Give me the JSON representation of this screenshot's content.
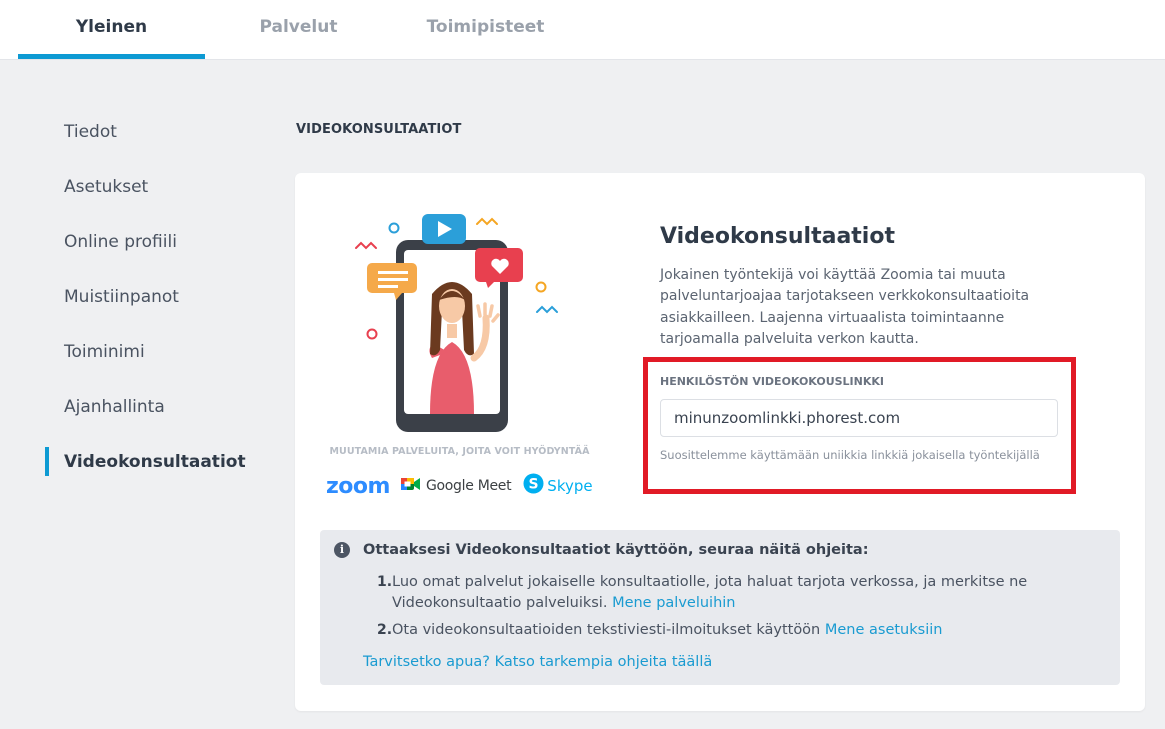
{
  "tabs": [
    {
      "label": "Yleinen",
      "active": true
    },
    {
      "label": "Palvelut",
      "active": false
    },
    {
      "label": "Toimipisteet",
      "active": false
    }
  ],
  "sidebar": {
    "items": [
      {
        "label": "Tiedot"
      },
      {
        "label": "Asetukset"
      },
      {
        "label": "Online profiili"
      },
      {
        "label": "Muistiinpanot"
      },
      {
        "label": "Toiminimi"
      },
      {
        "label": "Ajanhallinta"
      },
      {
        "label": "Videokonsultaatiot",
        "active": true
      }
    ]
  },
  "section": {
    "title": "VIDEOKONSULTAATIOT"
  },
  "card": {
    "services_caption": "MUUTAMIA PALVELUITA, JOITA VOIT HYÖDYNTÄÄ",
    "logos": {
      "zoom": "zoom",
      "google_meet": "Google Meet",
      "skype": "Skype"
    },
    "heading": "Videokonsultaatiot",
    "description": "Jokainen työntekijä voi käyttää Zoomia tai muuta palveluntarjoajaa tarjotakseen verkkokonsultaatioita asiakkailleen. Laajenna virtuaalista toimintaanne tarjoamalla palveluita verkon kautta.",
    "link_label": "HENKILÖSTÖN VIDEOKOKOUSLINKKI",
    "link_value": "minunzoomlinkki.phorest.com",
    "link_hint": "Suosittelemme käyttämään uniikkia linkkiä jokaisella työntekijällä",
    "highlight_color": "#e11a26"
  },
  "info": {
    "title": "Ottaaksesi Videokonsultaatiot käyttöön, seuraa näitä ohjeita:",
    "steps": [
      {
        "num": "1.",
        "text": "Luo omat palvelut jokaiselle konsultaatiolle, jota haluat tarjota verkossa, ja merkitse ne Videokonsultaatio palveluiksi. ",
        "link": "Mene palveluihin"
      },
      {
        "num": "2.",
        "text": "Ota videokonsultaatioiden tekstiviesti-ilmoitukset käyttöön ",
        "link": "Mene asetuksiin"
      }
    ],
    "help_link": "Tarvitsetko apua? Katso tarkempia ohjeita täällä"
  },
  "colors": {
    "accent": "#0d9ad3",
    "link": "#1a9bd1",
    "highlight": "#e11a26"
  }
}
